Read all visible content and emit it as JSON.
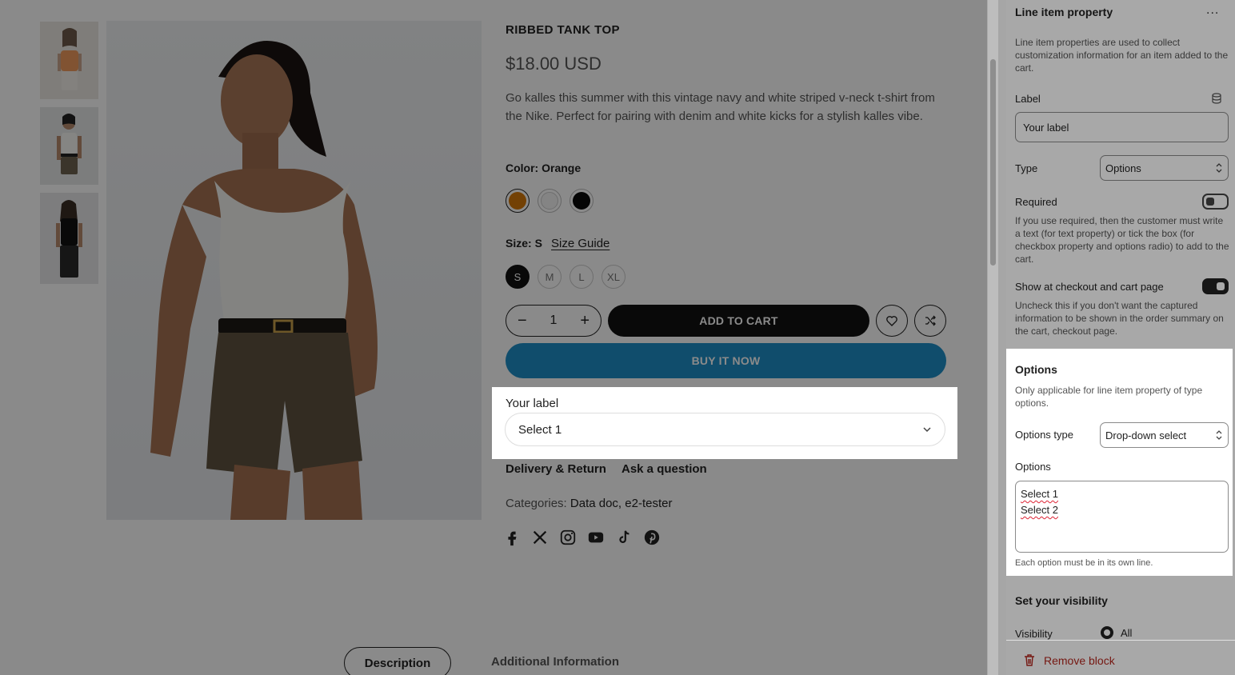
{
  "product": {
    "title": "RIBBED TANK TOP",
    "price": "$18.00 USD",
    "description": "Go kalles this summer with this vintage navy and white striped v-neck t-shirt from the Nike. Perfect for pairing with denim and white kicks for a stylish kalles vibe.",
    "color_label": "Color: Orange",
    "colors": [
      "#d4790b",
      "#f4f4f4",
      "#0a0a0a"
    ],
    "size_label": "Size: S",
    "size_guide": "Size Guide",
    "sizes": [
      "S",
      "M",
      "L",
      "XL"
    ],
    "quantity": "1",
    "add_to_cart": "ADD TO CART",
    "buy_now": "BUY IT NOW",
    "custom_field": {
      "label": "Your label",
      "selected": "Select 1"
    },
    "delivery_link": "Delivery & Return",
    "ask_link": "Ask a question",
    "categories_label": "Categories:",
    "categories_value": "Data doc, e2-tester",
    "social_icons": [
      "facebook-icon",
      "x-icon",
      "instagram-icon",
      "youtube-icon",
      "tiktok-icon",
      "pinterest-icon"
    ],
    "tabs": [
      "Description",
      "Additional Information"
    ]
  },
  "panel": {
    "title": "Line item property",
    "menu": "...",
    "intro": "Line item properties are used to collect customization information for an item added to the cart.",
    "label_field": {
      "label": "Label",
      "value": "Your label"
    },
    "type_field": {
      "label": "Type",
      "value": "Options"
    },
    "required": {
      "label": "Required",
      "enabled": false,
      "help": "If you use required, then the customer must write a text (for text property) or tick the box (for checkbox property and options radio) to add to the cart."
    },
    "show_checkout": {
      "label": "Show at checkout and cart page",
      "enabled": true,
      "help": "Uncheck this if you don't want the captured information to be shown in the order summary on the cart, checkout page."
    },
    "options_section": {
      "title": "Options",
      "help": "Only applicable for line item property of type options.",
      "options_type_label": "Options type",
      "options_type_value": "Drop-down select",
      "options_label": "Options",
      "options": [
        "Select 1",
        "Select 2"
      ],
      "footnote": "Each option must be in its own line."
    },
    "visibility": {
      "title": "Set your visibility",
      "label": "Visibility",
      "value": "All"
    },
    "remove": "Remove block"
  }
}
